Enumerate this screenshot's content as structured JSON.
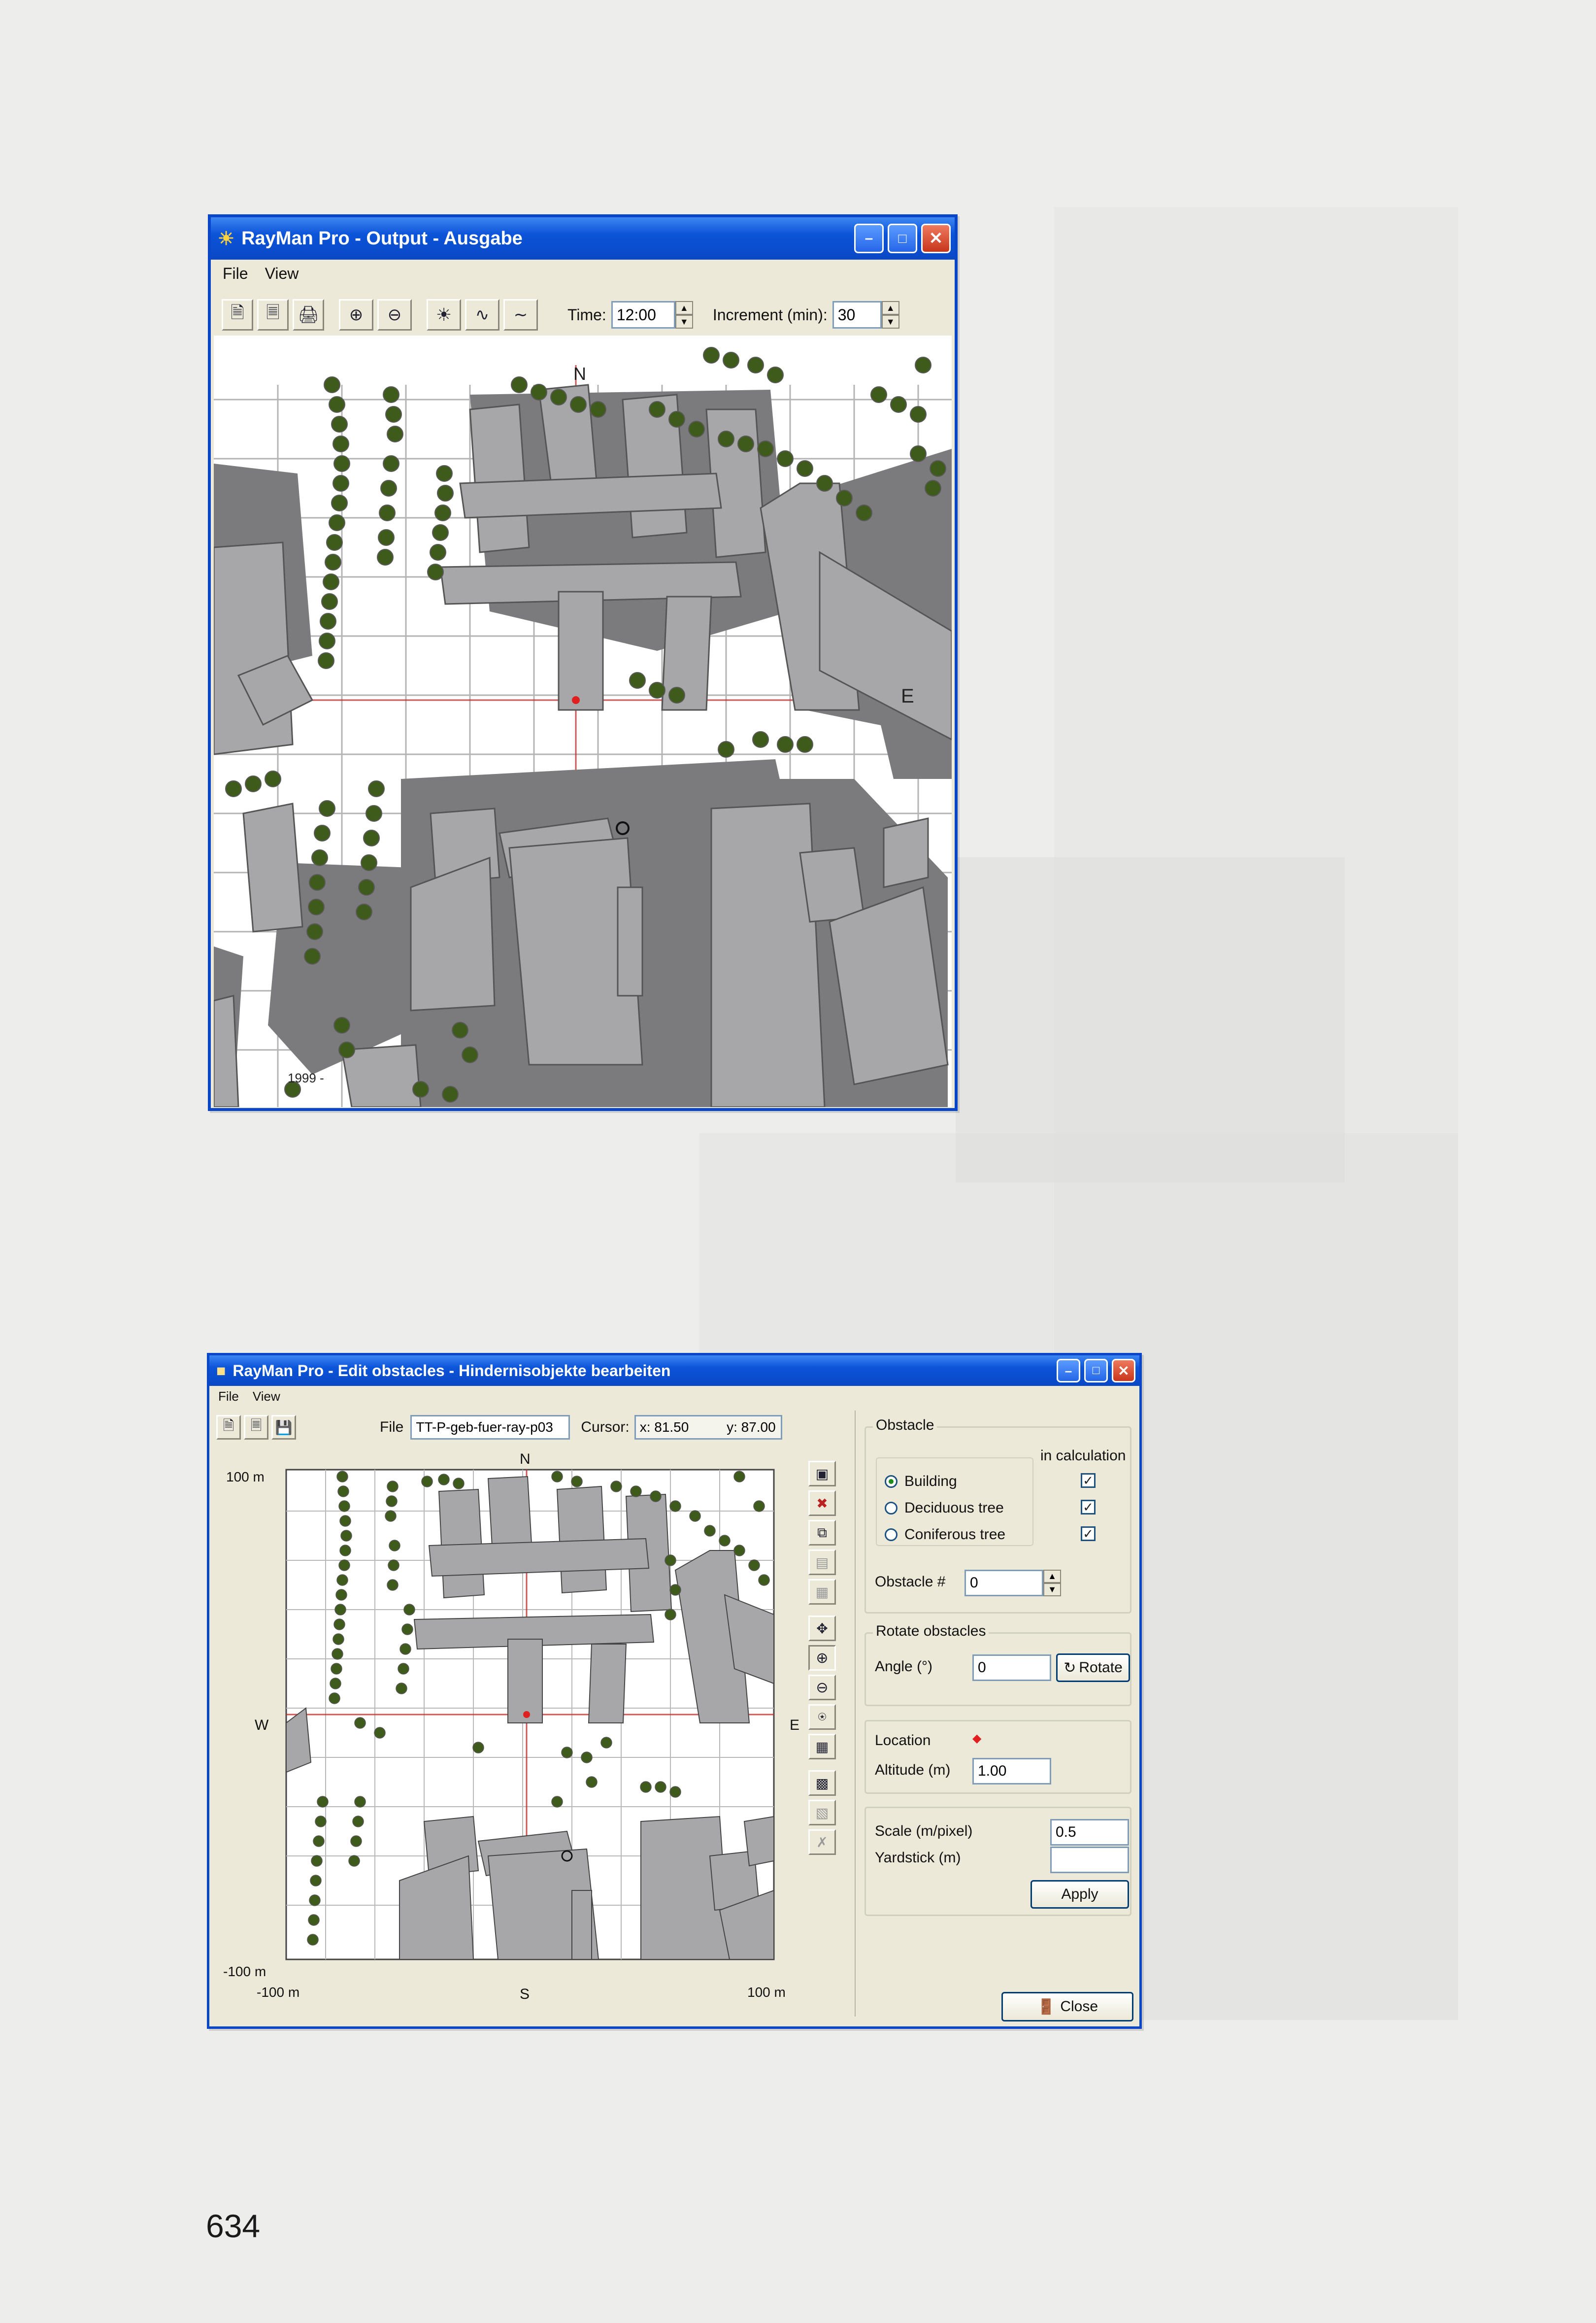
{
  "page": {
    "number": "634"
  },
  "output_window": {
    "title": "RayMan Pro - Output - Ausgabe",
    "menu": {
      "file": "File",
      "view": "View"
    },
    "toolbar": {
      "time_label": "Time:",
      "time_value": "12:00",
      "increment_label": "Increment (min):",
      "increment_value": "30"
    },
    "map": {
      "north": "N",
      "east": "E",
      "copyright": "1999 -"
    }
  },
  "edit_window": {
    "title": "RayMan Pro - Edit obstacles - Hindernisobjekte bearbeiten",
    "menu": {
      "file": "File",
      "view": "View"
    },
    "file_label": "File",
    "file_value": "TT-P-geb-fuer-ray-p03",
    "cursor_label": "Cursor:",
    "cursor_x": "x: 81.50",
    "cursor_y": "y: 87.00",
    "map": {
      "north": "N",
      "south": "S",
      "east": "E",
      "west": "W",
      "y_top": "100 m",
      "y_bottom": "-100 m",
      "x_left": "-100 m",
      "x_right": "100 m"
    },
    "obstacle_group": {
      "legend": "Obstacle",
      "in_calculation": "in calculation",
      "types": [
        "Building",
        "Deciduous tree",
        "Coniferous tree"
      ],
      "selected_type": "Building",
      "obstacle_no_label": "Obstacle #",
      "obstacle_no_value": "0"
    },
    "rotate_group": {
      "legend": "Rotate obstacles",
      "angle_label": "Angle (°)",
      "angle_value": "0",
      "rotate_button": "Rotate"
    },
    "location_group": {
      "location_label": "Location",
      "altitude_label": "Altitude (m)",
      "altitude_value": "1.00"
    },
    "scale_group": {
      "scale_label": "Scale (m/pixel)",
      "scale_value": "0.5",
      "yardstick_label": "Yardstick (m)",
      "yardstick_value": "",
      "apply_button": "Apply"
    },
    "close_button": "Close"
  },
  "colors": {
    "page": "#ededeb",
    "window_face": "#ece9d8",
    "titlebar": "#0a48c4",
    "building": "#a6a6a8",
    "shadow": "#7a7a7c",
    "tree": "#3f5b1c",
    "grid": "#b0b0b0",
    "grid_red": "#c03030"
  }
}
